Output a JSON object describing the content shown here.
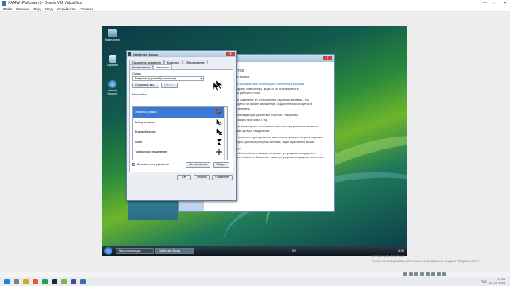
{
  "host": {
    "title": "XM4W (Работает) - Oracle VM VirtualBox",
    "menu": [
      "Файл",
      "Машина",
      "Вид",
      "Ввод",
      "Устройства",
      "Справка"
    ],
    "controls": [
      "—",
      "□",
      "✕"
    ]
  },
  "guest": {
    "desktop_icons": [
      {
        "label": "Компьютер",
        "icon": "computer-icon"
      },
      {
        "label": "Корзина",
        "icon": "recycle-bin-icon"
      },
      {
        "label": "Internet Explorer",
        "icon": "internet-explorer-icon"
      }
    ],
    "sound_window": {
      "heading": "звуковых эффектов",
      "lines": [
        "Настройка отображения значков.",
        "Стиль рисунка фоновых рисунков либо используйте собственные рисунки,",
        "или фона рисунков на экране компьютера, когда он не используется в",
        "фоновые рисунки, цвета рабочего стола.",
        "Изменение заставки или изменение ее отображения. Экранная заставка – это",
        "изображение, появляющееся на экране компьютера, когда он не используется в",
        "течение определенного времени.",
        "Изменение звуков, сопровождающих различные события – например,",
        "получение сообщения, запуск программ, и т.д.",
        "Выбор другого указателя мыши. Кроме того, можно изменить вид указателя мыши во",
        "время таких действий, как щелчок и выделение.",
        "Изменение темы. Тема позволяет одновременно изменить несколько настроек звуковых",
        "элементов: значки, шрифты, фоновый рисунок, заставки, звуки и указатели мыши.",
        "Параметры дисплея",
        "Настройка разрешающей способности экрана, позволяет регулировать мерцание и",
        "количество отображаемых объектов. Позволяет также регулировать мерцание монитора",
        "(частоту обновления)."
      ],
      "link": "Параметры дисплея"
    },
    "task_panel": [
      "См. также",
      "Панель задач и меню \"Пуск\"",
      "Специальные возможности"
    ],
    "mouse_dialog": {
      "title": "Свойства: Мышь",
      "close": "✕",
      "tabs_row1": [
        "Параметры указателя",
        "Колесико",
        "Оборудование"
      ],
      "tabs_row2": [
        "Кнопки мыши",
        "Указатели"
      ],
      "scheme_label": "Схема",
      "scheme_value": "Инверсная (огромный) (системная)",
      "save_as": "Сохранить как...",
      "delete": "Удалить",
      "customize_label": "Настройка:",
      "cursor_rows": [
        {
          "label": "Основной режим",
          "icon": "arrow-cursor-icon",
          "selected": true
        },
        {
          "label": "Выбор справки",
          "icon": "help-cursor-icon",
          "selected": false
        },
        {
          "label": "Фоновый режим",
          "icon": "working-cursor-icon",
          "selected": false
        },
        {
          "label": "Занят",
          "icon": "busy-cursor-icon",
          "selected": false
        },
        {
          "label": "Графическое выделение",
          "icon": "crosshair-cursor-icon",
          "selected": false
        }
      ],
      "shadow_checkbox": "Включить тень указателя",
      "shadow_checked": true,
      "default_btn": "По умолчанию",
      "browse_btn": "Обзор...",
      "ok": "OK",
      "cancel": "Отмена",
      "apply": "Применить"
    },
    "taskbar": {
      "tasks": [
        "Персонализация",
        "Свойства: Мышь"
      ],
      "active_index": 1,
      "lang": "EN",
      "clock": "14:59"
    }
  },
  "watermark": {
    "line1": "Активация Windows",
    "line2": "Чтобы активировать Windows, перейдите в раздел \"Параметры\"."
  },
  "host_taskbar": {
    "tray_lang": "РУС",
    "time": "14:59",
    "date": "03.04.2023"
  },
  "colors": {
    "accent": "#3b79d4",
    "guest_wallpaper": "#2a8a3c",
    "dialog_bg": "#ebeef2"
  }
}
